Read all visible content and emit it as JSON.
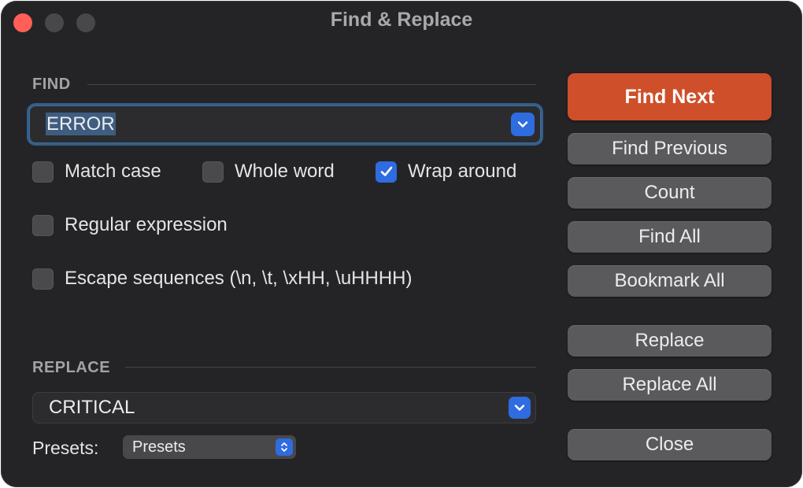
{
  "window": {
    "title": "Find & Replace"
  },
  "find": {
    "section_label": "FIND",
    "value": "ERROR"
  },
  "options": {
    "match_case": {
      "label": "Match case",
      "checked": false
    },
    "whole_word": {
      "label": "Whole word",
      "checked": false
    },
    "wrap_around": {
      "label": "Wrap around",
      "checked": true
    },
    "regular_expression": {
      "label": "Regular expression",
      "checked": false
    },
    "escape_sequences": {
      "label": "Escape sequences (\\n, \\t, \\xHH, \\uHHHH)",
      "checked": false
    }
  },
  "replace": {
    "section_label": "REPLACE",
    "value": "CRITICAL"
  },
  "presets": {
    "label": "Presets:",
    "selected": "Presets"
  },
  "buttons": {
    "find_next": "Find Next",
    "find_previous": "Find Previous",
    "count": "Count",
    "find_all": "Find All",
    "bookmark_all": "Bookmark All",
    "replace": "Replace",
    "replace_all": "Replace All",
    "close": "Close"
  },
  "colors": {
    "window_bg": "#242427",
    "accent_blue": "#2e6ce0",
    "primary_button": "#ce4f29",
    "secondary_button": "#5a5a5d",
    "close_light": "#ff5f57"
  },
  "icons": {
    "combo_arrow": "chevron-down-icon",
    "popup_stepper": "up-down-chevron-icon",
    "check": "checkmark-icon"
  }
}
